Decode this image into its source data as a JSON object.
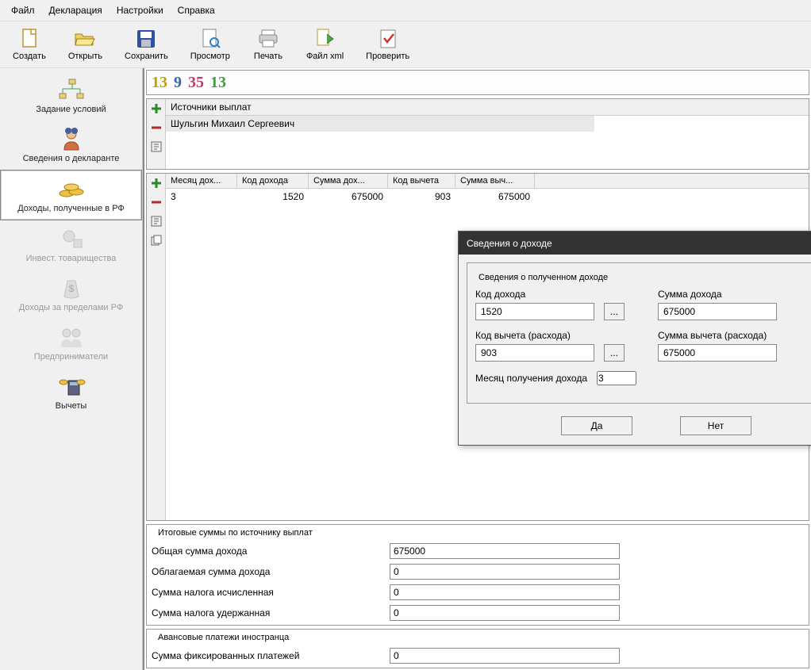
{
  "menubar": [
    "Файл",
    "Декларация",
    "Настройки",
    "Справка"
  ],
  "toolbar": [
    {
      "label": "Создать",
      "icon": "new"
    },
    {
      "label": "Открыть",
      "icon": "open"
    },
    {
      "label": "Сохранить",
      "icon": "save"
    },
    {
      "label": "Просмотр",
      "icon": "preview"
    },
    {
      "label": "Печать",
      "icon": "print"
    },
    {
      "label": "Файл xml",
      "icon": "xml"
    },
    {
      "label": "Проверить",
      "icon": "check"
    }
  ],
  "nav": [
    {
      "label": "Задание условий",
      "disabled": false
    },
    {
      "label": "Сведения о декларанте",
      "disabled": false
    },
    {
      "label": "Доходы, полученные в РФ",
      "disabled": false,
      "selected": true
    },
    {
      "label": "Инвест. товарищества",
      "disabled": true
    },
    {
      "label": "Доходы за пределами РФ",
      "disabled": true
    },
    {
      "label": "Предприниматели",
      "disabled": true
    },
    {
      "label": "Вычеты",
      "disabled": false
    }
  ],
  "rates": [
    {
      "value": "13",
      "color": "#c0a000"
    },
    {
      "value": "9",
      "color": "#3a66b0"
    },
    {
      "value": "35",
      "color": "#c03a6a"
    },
    {
      "value": "13",
      "color": "#3aa03a"
    }
  ],
  "sources": {
    "header": "Источники выплат",
    "rows": [
      "Шульгин Михаил Сергеевич"
    ]
  },
  "income_table": {
    "headers": [
      "Месяц дох...",
      "Код дохода",
      "Сумма дох...",
      "Код вычета",
      "Сумма выч..."
    ],
    "rows": [
      {
        "month": "3",
        "code": "1520",
        "sum": "675000",
        "ded_code": "903",
        "ded_sum": "675000"
      }
    ]
  },
  "totals": {
    "title": "Итоговые суммы по источнику выплат",
    "rows": [
      {
        "label": "Общая сумма дохода",
        "value": "675000"
      },
      {
        "label": "Облагаемая сумма дохода",
        "value": "0"
      },
      {
        "label": "Сумма налога исчисленная",
        "value": "0"
      },
      {
        "label": "Сумма налога удержанная",
        "value": "0"
      }
    ]
  },
  "advances": {
    "title": "Авансовые платежи иностранца",
    "label": "Сумма фиксированных платежей",
    "value": "0"
  },
  "dialog": {
    "title": "Сведения о доходе",
    "fieldset_title": "Сведения о полученном доходе",
    "code_label": "Код дохода",
    "code_value": "1520",
    "sum_label": "Сумма дохода",
    "sum_value": "675000",
    "ded_code_label": "Код вычета (расхода)",
    "ded_code_value": "903",
    "ded_sum_label": "Сумма вычета (расхода)",
    "ded_sum_value": "675000",
    "month_label": "Месяц получения дохода",
    "month_value": "3",
    "ok": "Да",
    "cancel": "Нет"
  }
}
